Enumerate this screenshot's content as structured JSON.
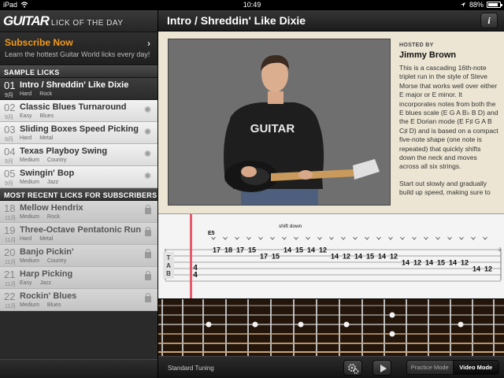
{
  "status": {
    "carrier": "iPad",
    "time": "10:49",
    "battery": "88%",
    "battery_level": 0.88
  },
  "brand": {
    "logo": "GUITAR",
    "tagline": "LICK OF THE DAY"
  },
  "subscribe": {
    "title": "Subscribe Now",
    "subtitle": "Learn the hottest Guitar World licks every day!"
  },
  "sample_header": "SAMPLE LICKS",
  "sample_licks": [
    {
      "num": "01",
      "month": "9月",
      "title": "Intro / Shreddin' Like Dixie",
      "level": "Hard",
      "genre": "Rock"
    },
    {
      "num": "02",
      "month": "9月",
      "title": "Classic Blues Turnaround",
      "level": "Easy",
      "genre": "Blues"
    },
    {
      "num": "03",
      "month": "9月",
      "title": "Sliding Boxes Speed Picking",
      "level": "Hard",
      "genre": "Metal"
    },
    {
      "num": "04",
      "month": "9月",
      "title": "Texas Playboy Swing",
      "level": "Medium",
      "genre": "Country"
    },
    {
      "num": "05",
      "month": "9月",
      "title": "Swingin' Bop",
      "level": "Medium",
      "genre": "Jazz"
    }
  ],
  "recent_header": "MOST RECENT LICKS FOR SUBSCRIBERS",
  "recent_licks": [
    {
      "num": "18",
      "month": "11月",
      "title": "Mellow Hendrix",
      "level": "Medium",
      "genre": "Rock"
    },
    {
      "num": "19",
      "month": "11月",
      "title": "Three-Octave Pentatonic Run",
      "level": "Hard",
      "genre": "Metal"
    },
    {
      "num": "20",
      "month": "11月",
      "title": "Banjo Pickin'",
      "level": "Medium",
      "genre": "Country"
    },
    {
      "num": "21",
      "month": "11月",
      "title": "Harp Picking",
      "level": "Easy",
      "genre": "Jazz"
    },
    {
      "num": "22",
      "month": "11月",
      "title": "Rockin' Blues",
      "level": "Medium",
      "genre": "Blues"
    }
  ],
  "main": {
    "title": "Intro / Shreddin' Like Dixie",
    "info": "i",
    "hosted_by_label": "HOSTED BY",
    "host": "Jimmy Brown",
    "desc1": "This is a cascading 16th-note triplet run in the style of Steve Morse that works well over either E major or E minor. It incorporates notes from both the E blues scale (E G A B♭ B D) and the E Dorian mode (E F♯ G A B C♯ D) and is based on a compact five-note shape (one note is repeated) that quickly shifts down the neck and moves across all six strings.",
    "desc2": "Start out slowly and gradually build up speed, making sure to"
  },
  "video": {
    "shirt_text": "GUITAR"
  },
  "tab": {
    "chord": "E5",
    "annotation": "shift down",
    "clef": [
      "T",
      "A",
      "B"
    ],
    "time_sig": [
      "4",
      "4"
    ],
    "measure_number": "2",
    "notes": [
      {
        "s": 1,
        "f": "17"
      },
      {
        "s": 1,
        "f": "18"
      },
      {
        "s": 1,
        "f": "17"
      },
      {
        "s": 1,
        "f": "15"
      },
      {
        "s": 2,
        "f": "17"
      },
      {
        "s": 2,
        "f": "15"
      },
      {
        "s": 1,
        "f": "14"
      },
      {
        "s": 1,
        "f": "15"
      },
      {
        "s": 1,
        "f": "14"
      },
      {
        "s": 1,
        "f": "12"
      },
      {
        "s": 2,
        "f": "14"
      },
      {
        "s": 2,
        "f": "12"
      },
      {
        "s": 2,
        "f": "14"
      },
      {
        "s": 2,
        "f": "15"
      },
      {
        "s": 2,
        "f": "14"
      },
      {
        "s": 2,
        "f": "12"
      },
      {
        "s": 3,
        "f": "14"
      },
      {
        "s": 3,
        "f": "12"
      },
      {
        "s": 3,
        "f": "14"
      },
      {
        "s": 3,
        "f": "15"
      },
      {
        "s": 3,
        "f": "14"
      },
      {
        "s": 3,
        "f": "12"
      },
      {
        "s": 4,
        "f": "14"
      },
      {
        "s": 4,
        "f": "12"
      }
    ]
  },
  "bottom": {
    "tuning": "Standard Tuning",
    "practice": "Practice Mode",
    "video": "Video Mode"
  },
  "colors": {
    "accent": "#f29a1c",
    "cursor": "#e85a6a",
    "content_bg": "#ece5d3"
  }
}
